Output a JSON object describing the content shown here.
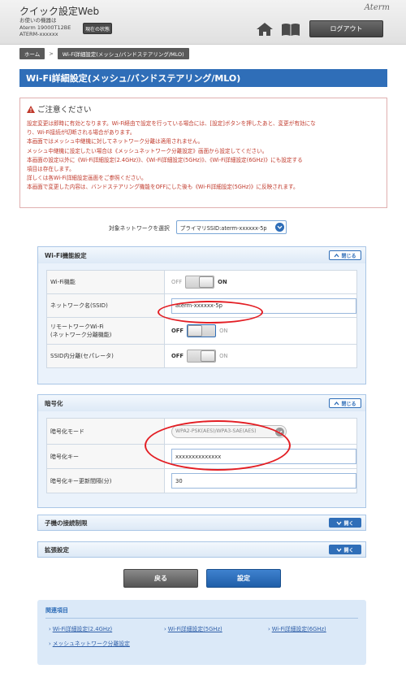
{
  "header": {
    "app_title": "クイック設定Web",
    "device_line1": "お使いの機器は",
    "device_line2": "Aterm 19000T12BE",
    "device_line3": "ATERM-xxxxxx",
    "status_button": "現在の状態",
    "brand": "Aterm",
    "logout_button": "ログアウト"
  },
  "breadcrumb": {
    "home": "ホーム",
    "separator": ">",
    "current": "Wi-Fi詳細設定(メッシュ/バンドステアリング/MLO)"
  },
  "page_title": "Wi-Fi詳細設定(メッシュ/バンドステアリング/MLO)",
  "notice": {
    "heading": "ご注意ください",
    "lines": [
      "設定変更は即時に有効となります。Wi-Fi経由で設定を行っている場合には、[設定]ボタンを押したあと、変更が有効にな",
      "り、Wi-Fi接続が切断される場合があります。",
      "本画面ではメッシュ中継機に対してネットワーク分離は適用されません。",
      "メッシュ中継機に設定したい場合は《メッシュネットワーク分離設定》画面から設定してください。",
      "本画面の設定以外に《Wi-Fi詳細設定(2.4GHz)》、《Wi-Fi詳細設定(5GHz)》、《Wi-Fi詳細設定(6GHz)》にも設定する",
      "項目は存在します。",
      "詳しくは各Wi-Fi詳細設定画面をご参照ください。",
      "本画面で変更した内容は、バンドステアリング機能をOFFにした後も《Wi-Fi詳細設定(5GHz)》に反映されます。"
    ]
  },
  "network_selector": {
    "label": "対象ネットワークを選択",
    "selected": "プライマリSSID:aterm-xxxxxx-5p"
  },
  "wifi_section": {
    "title": "Wi-Fi機能設定",
    "toggle": "閉じる",
    "rows": {
      "wifi_function": {
        "label": "Wi-Fi機能",
        "off": "OFF",
        "on": "ON"
      },
      "ssid": {
        "label": "ネットワーク名(SSID)",
        "value": "aterm-xxxxxx-5p"
      },
      "remote_line1": "リモートワークWi-Fi",
      "remote_line2": "(ネットワーク分離機能)",
      "remote": {
        "off": "OFF",
        "on": "ON"
      },
      "separator": {
        "label": "SSID内分離(セパレータ)",
        "off": "OFF",
        "on": "ON"
      }
    }
  },
  "encryption_section": {
    "title": "暗号化",
    "toggle": "閉じる",
    "mode_label": "暗号化モード",
    "mode_value": "WPA2-PSK(AES)/WPA3-SAE(AES)",
    "key_label": "暗号化キー",
    "key_value": "xxxxxxxxxxxxxx",
    "interval_label": "暗号化キー更新間隔(分)",
    "interval_value": "30"
  },
  "collapsed_sections": [
    {
      "title": "子機の接続制限",
      "toggle": "開く"
    },
    {
      "title": "拡張設定",
      "toggle": "開く"
    }
  ],
  "actions": {
    "back": "戻る",
    "set": "設定"
  },
  "related": {
    "title": "関連項目",
    "links": [
      "Wi-Fi詳細設定(2.4GHz)",
      "Wi-Fi詳細設定(5GHz)",
      "Wi-Fi詳細設定(6GHz)",
      "メッシュネットワーク分離設定"
    ]
  },
  "colors": {
    "primary_blue": "#2f6eb8",
    "warning_red": "#c0392b",
    "annotation_red": "#e31e24"
  }
}
